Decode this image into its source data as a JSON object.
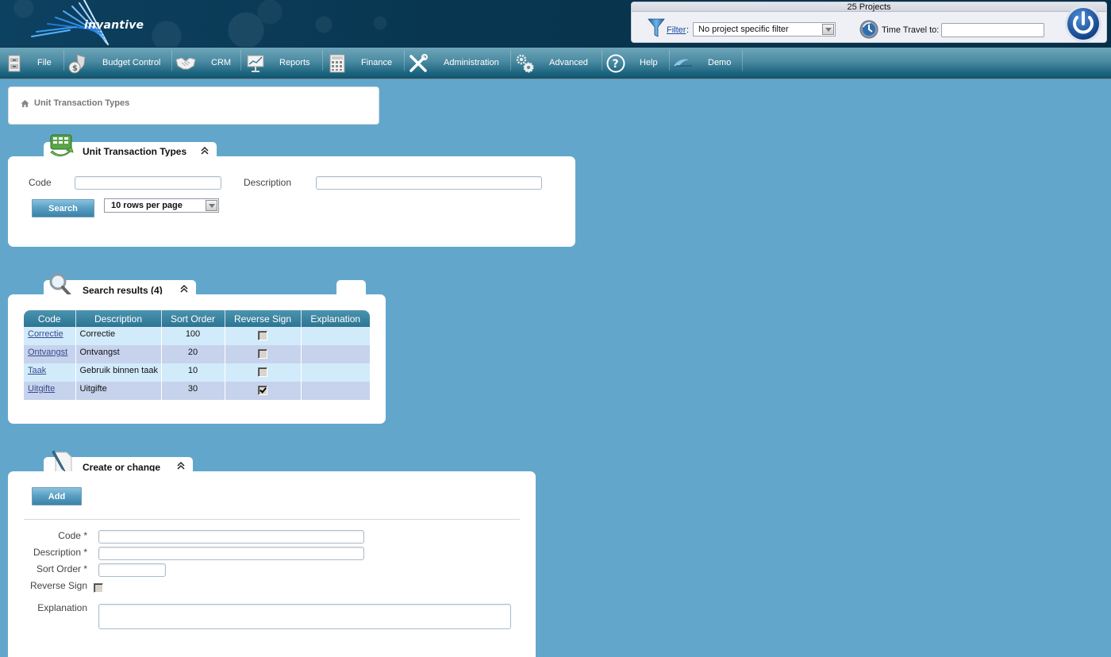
{
  "header": {
    "logo_text": "invantive",
    "project_count": "25 Projects",
    "filter_link": "Filter",
    "filter_colon": ":",
    "filter_value": "No project specific filter",
    "time_travel_label": "Time Travel to:",
    "time_travel_value": ""
  },
  "menu": [
    {
      "label": "File",
      "icon": "file-cabinet-icon"
    },
    {
      "label": "Budget Control",
      "icon": "money-shield-icon"
    },
    {
      "label": "CRM",
      "icon": "handshake-icon"
    },
    {
      "label": "Reports",
      "icon": "presentation-chart-icon"
    },
    {
      "label": "Finance",
      "icon": "calculator-icon"
    },
    {
      "label": "Administration",
      "icon": "tools-icon"
    },
    {
      "label": "Advanced",
      "icon": "gears-icon"
    },
    {
      "label": "Help",
      "icon": "help-icon"
    },
    {
      "label": "Demo",
      "icon": "demo-logo-icon"
    }
  ],
  "breadcrumb": {
    "current": "Unit Transaction Types"
  },
  "search_panel": {
    "title": "Unit Transaction Types",
    "code_label": "Code",
    "code_value": "",
    "description_label": "Description",
    "description_value": "",
    "search_button": "Search",
    "rows_per_page": "10 rows per page"
  },
  "results_panel": {
    "title": "Search results (4)",
    "columns": [
      "Code",
      "Description",
      "Sort Order",
      "Reverse Sign",
      "Explanation"
    ],
    "rows": [
      {
        "code": "Correctie",
        "description": "Correctie",
        "sort_order": "100",
        "reverse_sign": false,
        "explanation": ""
      },
      {
        "code": "Ontvangst",
        "description": "Ontvangst",
        "sort_order": "20",
        "reverse_sign": false,
        "explanation": ""
      },
      {
        "code": "Taak",
        "description": "Gebruik binnen taak",
        "sort_order": "10",
        "reverse_sign": false,
        "explanation": ""
      },
      {
        "code": "Uitgifte",
        "description": "Uitgifte",
        "sort_order": "30",
        "reverse_sign": true,
        "explanation": ""
      }
    ]
  },
  "form_panel": {
    "title": "Create or change",
    "add_button": "Add",
    "code_label": "Code *",
    "description_label": "Description *",
    "sort_order_label": "Sort Order *",
    "reverse_sign_label": "Reverse Sign",
    "reverse_sign_checked": false,
    "explanation_label": "Explanation",
    "code_value": "",
    "description_value": "",
    "sort_order_value": "",
    "explanation_value": ""
  },
  "colors": {
    "page_background": "#62a7cb",
    "header_dark": "#083650",
    "table_header": "#2b7592",
    "row_odd": "#d2ebfb",
    "row_even": "#c7d3ec",
    "link": "#3a4a8c"
  }
}
